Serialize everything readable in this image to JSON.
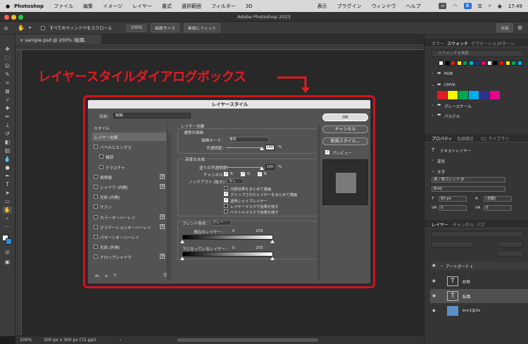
{
  "menubar": {
    "app": "Photoshop",
    "items": [
      "ファイル",
      "編集",
      "イメージ",
      "レイヤー",
      "書式",
      "選択範囲",
      "フィルター",
      "3D",
      "表示",
      "プラグイン",
      "ウィンドウ",
      "ヘルプ"
    ],
    "clock": "17:49"
  },
  "window": {
    "title": "Adobe Photoshop 2023"
  },
  "options": {
    "scroll_all": "すべてのウィンドウをスクロール",
    "zoom": "100%",
    "fit_screen": "画面サイズ",
    "fill_screen": "画面にフィット",
    "share": "共有"
  },
  "document": {
    "tab": "sample.psd @ 200% (転職, RGB/8)",
    "zoom": "100%",
    "size": "300 px x 300 px (72 ppi)"
  },
  "annotation": {
    "text": "レイヤースタイルダイアログボックス"
  },
  "dialog": {
    "title": "レイヤースタイル",
    "name_label": "名前：",
    "name_value": "転職",
    "styles_header": "スタイル",
    "styles": [
      {
        "label": "レイヤー効果",
        "selected": true,
        "checkbox": false,
        "plus": false,
        "indent": false
      },
      {
        "label": "ベベルとエンボス",
        "checkbox": true,
        "plus": false,
        "indent": false
      },
      {
        "label": "輪郭",
        "checkbox": true,
        "plus": false,
        "indent": true
      },
      {
        "label": "テクスチャ",
        "checkbox": true,
        "plus": false,
        "indent": true
      },
      {
        "label": "境界線",
        "checkbox": true,
        "plus": true,
        "indent": false
      },
      {
        "label": "シャドウ (内側)",
        "checkbox": true,
        "plus": true,
        "indent": false
      },
      {
        "label": "光彩 (内側)",
        "checkbox": true,
        "plus": false,
        "indent": false
      },
      {
        "label": "サテン",
        "checkbox": true,
        "plus": false,
        "indent": false
      },
      {
        "label": "カラーオーバーレイ",
        "checkbox": true,
        "plus": true,
        "indent": false
      },
      {
        "label": "グラデーションオーバーレイ",
        "checkbox": true,
        "plus": true,
        "indent": false
      },
      {
        "label": "パターンオーバーレイ",
        "checkbox": true,
        "plus": false,
        "indent": false
      },
      {
        "label": "光彩 (外側)",
        "checkbox": true,
        "plus": false,
        "indent": false
      },
      {
        "label": "ドロップシャドウ",
        "checkbox": true,
        "plus": true,
        "indent": false
      }
    ],
    "fx": "fx.",
    "section_title": "レイヤー効果",
    "general_title": "通常の描画",
    "blend_mode_label": "描画モード：",
    "blend_mode_value": "通常",
    "opacity_label": "不透明度：",
    "opacity_value": "100",
    "percent": "%",
    "advanced_title": "高度な合成",
    "fill_label": "塗りの不透明度：",
    "fill_value": "100",
    "channels_label": "チャンネル：",
    "ch_r": "R",
    "ch_g": "G",
    "ch_b": "B",
    "knockout_label": "ノックアウト (抜き)：",
    "knockout_value": "なし",
    "options": [
      {
        "label": "内部効果をまとめて描画",
        "checked": false
      },
      {
        "label": "クリップされたレイヤーをまとめて描画",
        "checked": true
      },
      {
        "label": "透明シェイプレイヤー",
        "checked": true
      },
      {
        "label": "レイヤーマスクで効果を隠す",
        "checked": false
      },
      {
        "label": "ベクトルマスクで効果を隠す",
        "checked": false
      }
    ],
    "blendif_label": "ブレンド条件：",
    "blendif_value": "グレー",
    "this_layer_label": "現在のレイヤー：",
    "this_low": "0",
    "this_high": "255",
    "under_layer_label": "下になっているレイヤー：",
    "under_low": "0",
    "under_high": "255",
    "ok": "OK",
    "cancel": "キャンセル",
    "new_style": "新規スタイル...",
    "preview": "プレビュー"
  },
  "swatches": {
    "tabs": [
      "カラー",
      "スウォッチ",
      "グラデーション",
      "パターン"
    ],
    "search": "スウォッチを検索",
    "groups": [
      "RGB",
      "CMYK",
      "グレースケール",
      "パステル"
    ],
    "colors": [
      "#ffffff",
      "#000000",
      "#e11b22",
      "#fff200",
      "#00a651",
      "#00aeef",
      "#2e3192",
      "#ec008c"
    ]
  },
  "properties": {
    "tabs": [
      "プロパティ",
      "色調補正",
      "CC ライブラリ"
    ],
    "type_layer": "テキストレイヤー",
    "transform": "変形",
    "character": "文字",
    "font": "源ノ角ゴシック JP",
    "weight": "Bold",
    "size": "80 px",
    "leading": "(自動)",
    "tracking": "0",
    "kerning": "0"
  },
  "layers": {
    "tabs": [
      "レイヤー",
      "チャンネル",
      "パス"
    ],
    "artboard": "アートボード 1",
    "items": [
      {
        "name": "診断",
        "type": "text"
      },
      {
        "name": "転職",
        "type": "text"
      },
      {
        "name": "bnr1@3x",
        "type": "image"
      }
    ]
  }
}
